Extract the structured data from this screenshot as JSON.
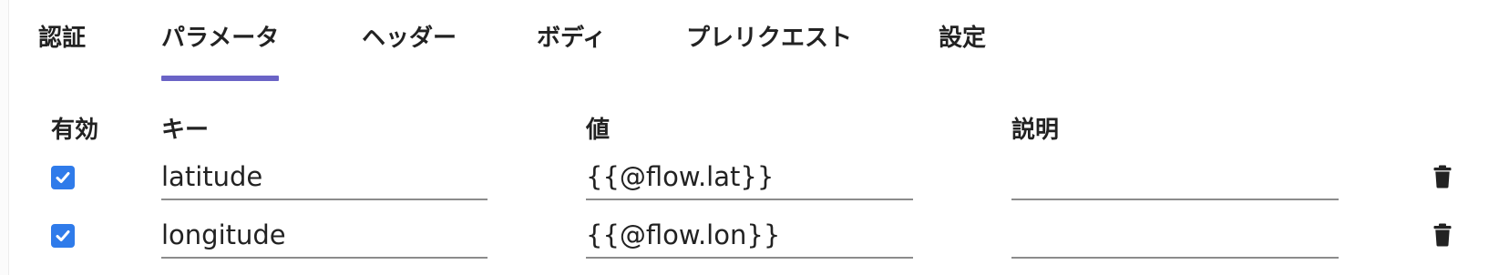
{
  "tabs": [
    {
      "label": "認証",
      "active": false
    },
    {
      "label": "パラメータ",
      "active": true
    },
    {
      "label": "ヘッダー",
      "active": false
    },
    {
      "label": "ボディ",
      "active": false
    },
    {
      "label": "プレリクエスト",
      "active": false
    },
    {
      "label": "設定",
      "active": false
    }
  ],
  "table": {
    "headers": {
      "enabled": "有効",
      "key": "キー",
      "value": "値",
      "description": "説明"
    },
    "rows": [
      {
        "enabled": true,
        "key": "latitude",
        "value": "{{@flow.lat}}",
        "description": "",
        "delete_icon": "trash-icon"
      },
      {
        "enabled": true,
        "key": "longitude",
        "value": "{{@flow.lon}}",
        "description": "",
        "delete_icon": "trash-icon"
      }
    ]
  },
  "colors": {
    "accent": "#6a63c6",
    "checkbox": "#2f7bea",
    "text": "#222222"
  }
}
